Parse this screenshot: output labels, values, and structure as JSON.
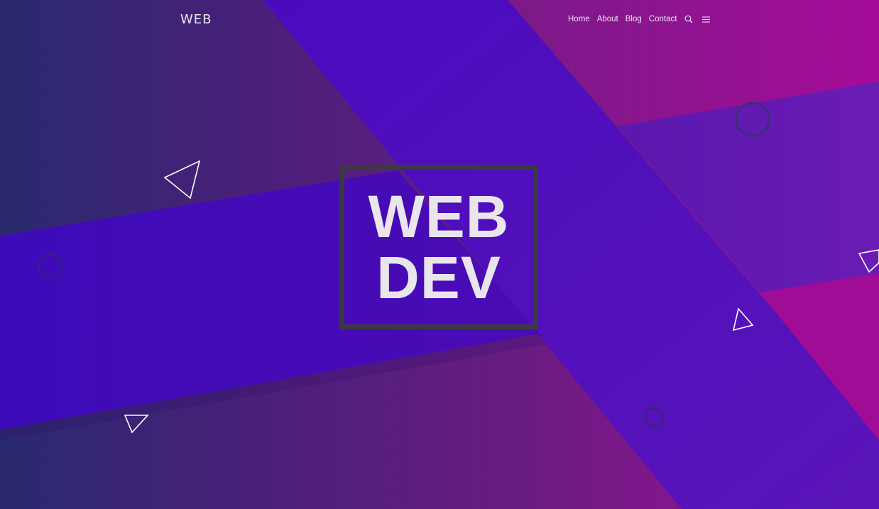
{
  "header": {
    "logo": "WEB",
    "nav": [
      {
        "label": "Home"
      },
      {
        "label": "About"
      },
      {
        "label": "Blog"
      },
      {
        "label": "Contact"
      }
    ],
    "icons": [
      "search-icon",
      "menu-icon"
    ]
  },
  "hero": {
    "line1": "WEB",
    "line2": "DEV"
  },
  "colors": {
    "indigo_band": "#4a0bb8",
    "magenta_accent": "#a10c95",
    "frame_border": "#3a3a3f",
    "text_light": "#e8e6ec"
  }
}
